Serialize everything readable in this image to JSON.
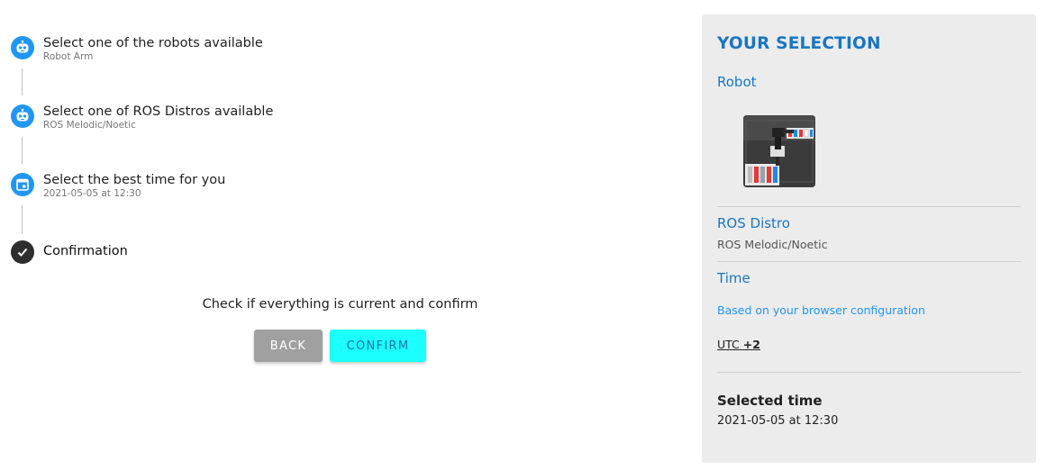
{
  "stepper": {
    "steps": [
      {
        "title": "Select one of the robots available",
        "subtitle": "Robot Arm",
        "icon": "robot-icon"
      },
      {
        "title": "Select one of ROS Distros available",
        "subtitle": "ROS Melodic/Noetic",
        "icon": "robot-icon"
      },
      {
        "title": "Select the best time for you",
        "subtitle": "2021-05-05 at 12:30",
        "icon": "calendar-icon"
      },
      {
        "title": "Confirmation",
        "subtitle": "",
        "icon": "check-icon"
      }
    ]
  },
  "confirm": {
    "message": "Check if everything is current and confirm",
    "back_label": "BACK",
    "confirm_label": "CONFIRM"
  },
  "selection": {
    "title": "YOUR SELECTION",
    "robot_label": "Robot",
    "distro_label": "ROS Distro",
    "distro_value": "ROS Melodic/Noetic",
    "time_label": "Time",
    "time_hint": "Based on your browser configuration",
    "utc_prefix": "UTC ",
    "utc_offset": "+2",
    "selected_time_label": "Selected time",
    "selected_time_value": "2021-05-05 at 12:30"
  },
  "colors": {
    "accent_blue": "#1976c2",
    "step_icon_blue": "#2196f3",
    "confirm_button": "#1cffff",
    "back_button": "#a0a0a0",
    "panel_bg": "#ececec"
  }
}
